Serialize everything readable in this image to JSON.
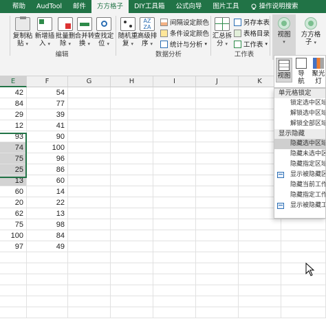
{
  "ribbon_tabs": [
    {
      "label": "帮助"
    },
    {
      "label": "AudTool"
    },
    {
      "label": "邮件"
    },
    {
      "label": "方方格子"
    },
    {
      "label": "DIY工具箱"
    },
    {
      "label": "公式向导"
    },
    {
      "label": "图片工具"
    },
    {
      "label": "操作说明搜索"
    }
  ],
  "ribbon": {
    "copy_paste": {
      "line1": "复制粘",
      "line2": "贴"
    },
    "new_insert": {
      "line1": "新增插",
      "line2": "入"
    },
    "batch_delete": {
      "line1": "批量删",
      "line2": "除"
    },
    "merge_convert": {
      "line1": "合并转",
      "line2": "换"
    },
    "find_locate": {
      "line1": "查找定",
      "line2": "位"
    },
    "group_edit": "编辑",
    "random_repeat": {
      "line1": "随机重",
      "line2": "复"
    },
    "advanced_sort": {
      "line1": "高级排",
      "line2": "序"
    },
    "interval_color": "间隔设定颜色",
    "conditional_color": "条件设定颜色",
    "stats_analysis": "统计与分析",
    "group_data_analysis": "数据分析",
    "summary_split": {
      "line1": "汇总拆",
      "line2": "分"
    },
    "save_table": "另存本表",
    "table_catalog": "表格目录",
    "worksheet": "工作表",
    "group_worksheet": "工作表",
    "view": {
      "line1": "视图"
    },
    "fangfang": {
      "line1": "方方格",
      "line2": "子"
    }
  },
  "sheet": {
    "columns": [
      "E",
      "F",
      "G",
      "H",
      "I",
      "J",
      "K"
    ],
    "col_e_values": [
      "42",
      "84",
      "29",
      "12",
      "93",
      "74",
      "75",
      "25",
      "13",
      "60",
      "20",
      "62",
      "75",
      "100",
      "97"
    ],
    "col_f_values": [
      "54",
      "77",
      "39",
      "41",
      "90",
      "100",
      "96",
      "86",
      "60",
      "14",
      "22",
      "13",
      "98",
      "84",
      "49"
    ],
    "selected_column": "E"
  },
  "panel": {
    "view": "视图",
    "nav": {
      "line1": "导",
      "line2": "航"
    },
    "spotlight": {
      "line1": "聚光",
      "line2": "灯"
    }
  },
  "menu": {
    "section_lock": "单元格锁定",
    "lock_selection": "锁定选中区域",
    "unlock_selection": "解锁选中区域",
    "unlock_all": "解锁全部区域",
    "section_show_hide": "显示隐藏",
    "hide_selection": "隐藏选中区域",
    "hide_unselected": "隐藏未选中区域",
    "hide_specified": "隐藏指定区域",
    "show_hidden_area": "显示被隐藏区域",
    "hide_current_sheet": "隐藏当前工作表",
    "hide_specified_sheet": "隐藏指定工作表",
    "show_hidden_sheet": "显示被隐藏工作表"
  }
}
